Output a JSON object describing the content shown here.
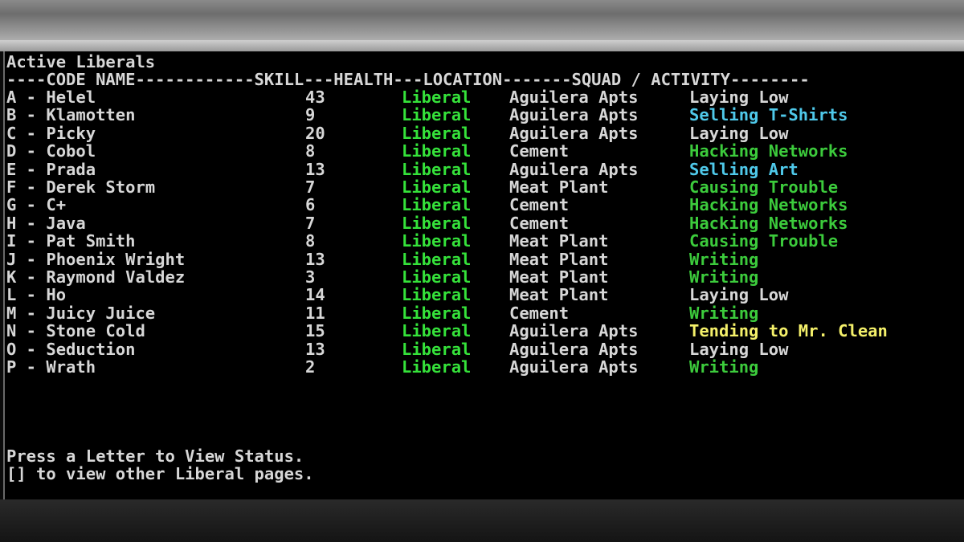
{
  "title": "Active Liberals",
  "header_line": "----CODE NAME------------SKILL---HEALTH---LOCATION-------SQUAD / ACTIVITY--------",
  "colors": {
    "text": "#d7d7d7",
    "health": "#35e23a",
    "activity_green": "#3ccb3c",
    "activity_cyan": "#4fc9ea",
    "activity_yellow": "#f4f06a",
    "activity_white": "#d7d7d7"
  },
  "rows": [
    {
      "letter": "A",
      "name": "Helel",
      "skill": "43",
      "health": "Liberal",
      "location": "Aguilera Apts",
      "activity": "Laying Low",
      "activity_color": "#d7d7d7"
    },
    {
      "letter": "B",
      "name": "Klamotten",
      "skill": "9",
      "health": "Liberal",
      "location": "Aguilera Apts",
      "activity": "Selling T-Shirts",
      "activity_color": "#4fc9ea"
    },
    {
      "letter": "C",
      "name": "Picky",
      "skill": "20",
      "health": "Liberal",
      "location": "Aguilera Apts",
      "activity": "Laying Low",
      "activity_color": "#d7d7d7"
    },
    {
      "letter": "D",
      "name": "Cobol",
      "skill": "8",
      "health": "Liberal",
      "location": "Cement",
      "activity": "Hacking Networks",
      "activity_color": "#3ccb3c"
    },
    {
      "letter": "E",
      "name": "Prada",
      "skill": "13",
      "health": "Liberal",
      "location": "Aguilera Apts",
      "activity": "Selling Art",
      "activity_color": "#4fc9ea"
    },
    {
      "letter": "F",
      "name": "Derek Storm",
      "skill": "7",
      "health": "Liberal",
      "location": "Meat Plant",
      "activity": "Causing Trouble",
      "activity_color": "#3ccb3c"
    },
    {
      "letter": "G",
      "name": "C+",
      "skill": "6",
      "health": "Liberal",
      "location": "Cement",
      "activity": "Hacking Networks",
      "activity_color": "#3ccb3c"
    },
    {
      "letter": "H",
      "name": "Java",
      "skill": "7",
      "health": "Liberal",
      "location": "Cement",
      "activity": "Hacking Networks",
      "activity_color": "#3ccb3c"
    },
    {
      "letter": "I",
      "name": "Pat Smith",
      "skill": "8",
      "health": "Liberal",
      "location": "Meat Plant",
      "activity": "Causing Trouble",
      "activity_color": "#3ccb3c"
    },
    {
      "letter": "J",
      "name": "Phoenix Wright",
      "skill": "13",
      "health": "Liberal",
      "location": "Meat Plant",
      "activity": "Writing",
      "activity_color": "#3ccb3c"
    },
    {
      "letter": "K",
      "name": "Raymond Valdez",
      "skill": "3",
      "health": "Liberal",
      "location": "Meat Plant",
      "activity": "Writing",
      "activity_color": "#3ccb3c"
    },
    {
      "letter": "L",
      "name": "Ho",
      "skill": "14",
      "health": "Liberal",
      "location": "Meat Plant",
      "activity": "Laying Low",
      "activity_color": "#d7d7d7"
    },
    {
      "letter": "M",
      "name": "Juicy Juice",
      "skill": "11",
      "health": "Liberal",
      "location": "Cement",
      "activity": "Writing",
      "activity_color": "#3ccb3c"
    },
    {
      "letter": "N",
      "name": "Stone Cold",
      "skill": "15",
      "health": "Liberal",
      "location": "Aguilera Apts",
      "activity": "Tending to Mr. Clean",
      "activity_color": "#f4f06a"
    },
    {
      "letter": "O",
      "name": "Seduction",
      "skill": "13",
      "health": "Liberal",
      "location": "Aguilera Apts",
      "activity": "Laying Low",
      "activity_color": "#d7d7d7"
    },
    {
      "letter": "P",
      "name": "Wrath",
      "skill": "2",
      "health": "Liberal",
      "location": "Aguilera Apts",
      "activity": "Writing",
      "activity_color": "#3ccb3c"
    }
  ],
  "footer": {
    "line1": "Press a Letter to View Status.",
    "line2": "[] to view other Liberal pages."
  }
}
